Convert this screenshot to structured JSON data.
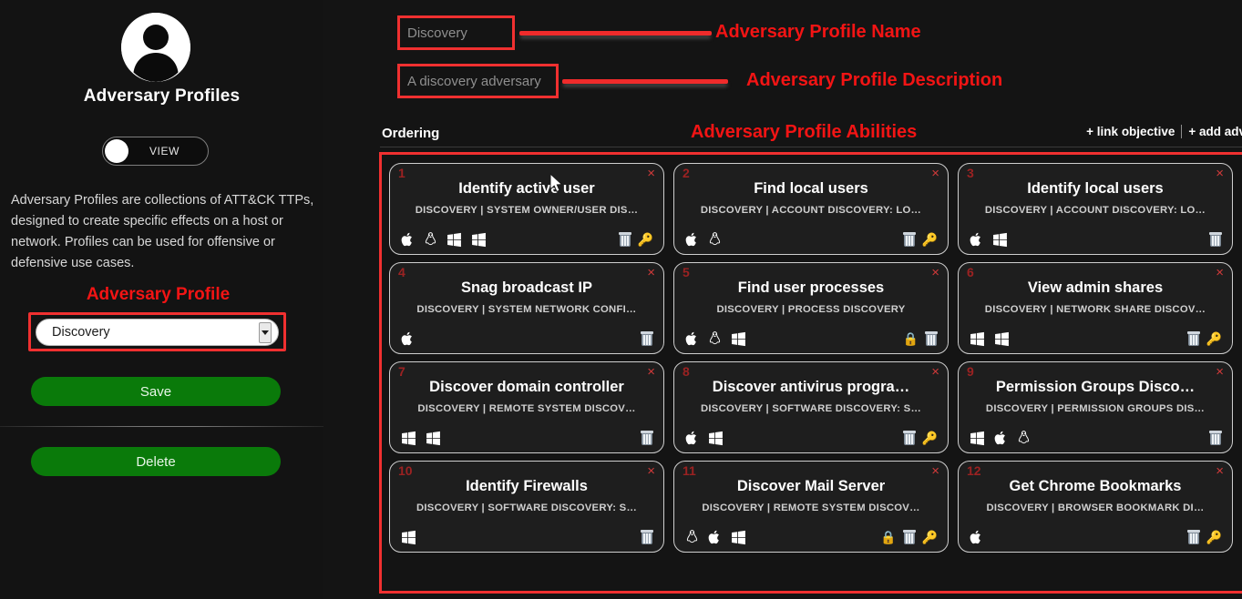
{
  "sidebar": {
    "avatar_icon": "user-avatar-icon",
    "title": "Adversary Profiles",
    "toggle_label": "VIEW",
    "description": "Adversary Profiles are collections of ATT&CK TTPs, designed to create specific effects on a host or network. Profiles can be used for offensive or defensive use cases.",
    "section_heading": "Adversary Profile",
    "select_value": "Discovery",
    "save_label": "Save",
    "delete_label": "Delete"
  },
  "main": {
    "profile_name_value": "Discovery",
    "profile_desc_value": "A discovery adversary",
    "ordering_label": "Ordering",
    "link_objective_label": "+ link objective",
    "add_adversary_label": "+ add adv"
  },
  "annotations": {
    "name": "Adversary Profile Name",
    "description": "Adversary Profile Description",
    "abilities": "Adversary Profile Abilities",
    "color": "#f31414"
  },
  "colors": {
    "accent_red": "#f03030",
    "green_button": "#0a7a0a",
    "card_bg": "#1e1e1e",
    "page_bg": "#131313"
  },
  "abilities": [
    {
      "num": "1",
      "title": "Identify active user",
      "tags": "DISCOVERY | SYSTEM OWNER/USER DIS…",
      "platforms": [
        "apple-icon",
        "linux-icon",
        "windows-icon",
        "windows-icon"
      ],
      "actions": [
        "trash-icon",
        "key-icon"
      ]
    },
    {
      "num": "2",
      "title": "Find local users",
      "tags": "DISCOVERY | ACCOUNT DISCOVERY: LO…",
      "platforms": [
        "apple-icon",
        "linux-icon"
      ],
      "actions": [
        "trash-icon",
        "key-icon"
      ]
    },
    {
      "num": "3",
      "title": "Identify local users",
      "tags": "DISCOVERY | ACCOUNT DISCOVERY: LO…",
      "platforms": [
        "apple-icon",
        "windows-icon"
      ],
      "actions": [
        "trash-icon"
      ]
    },
    {
      "num": "4",
      "title": "Snag broadcast IP",
      "tags": "DISCOVERY | SYSTEM NETWORK CONFI…",
      "platforms": [
        "apple-icon"
      ],
      "actions": [
        "trash-icon"
      ]
    },
    {
      "num": "5",
      "title": "Find user processes",
      "tags": "DISCOVERY | PROCESS DISCOVERY",
      "platforms": [
        "apple-icon",
        "linux-icon",
        "windows-icon"
      ],
      "actions": [
        "lock-icon",
        "trash-icon"
      ]
    },
    {
      "num": "6",
      "title": "View admin shares",
      "tags": "DISCOVERY | NETWORK SHARE DISCOV…",
      "platforms": [
        "windows-icon",
        "windows-icon"
      ],
      "actions": [
        "trash-icon",
        "key-icon"
      ]
    },
    {
      "num": "7",
      "title": "Discover domain controller",
      "tags": "DISCOVERY | REMOTE SYSTEM DISCOV…",
      "platforms": [
        "windows-icon",
        "windows-icon"
      ],
      "actions": [
        "trash-icon"
      ]
    },
    {
      "num": "8",
      "title": "Discover antivirus progra…",
      "tags": "DISCOVERY | SOFTWARE DISCOVERY: S…",
      "platforms": [
        "apple-icon",
        "windows-icon"
      ],
      "actions": [
        "trash-icon",
        "key-icon"
      ]
    },
    {
      "num": "9",
      "title": "Permission Groups Disco…",
      "tags": "DISCOVERY | PERMISSION GROUPS DIS…",
      "platforms": [
        "windows-icon",
        "apple-icon",
        "linux-icon"
      ],
      "actions": [
        "trash-icon"
      ]
    },
    {
      "num": "10",
      "title": "Identify Firewalls",
      "tags": "DISCOVERY | SOFTWARE DISCOVERY: S…",
      "platforms": [
        "windows-icon"
      ],
      "actions": [
        "trash-icon"
      ]
    },
    {
      "num": "11",
      "title": "Discover Mail Server",
      "tags": "DISCOVERY | REMOTE SYSTEM DISCOV…",
      "platforms": [
        "linux-icon",
        "apple-icon",
        "windows-icon"
      ],
      "actions": [
        "lock-icon",
        "trash-icon",
        "key-icon"
      ]
    },
    {
      "num": "12",
      "title": "Get Chrome Bookmarks",
      "tags": "DISCOVERY | BROWSER BOOKMARK DI…",
      "platforms": [
        "apple-icon"
      ],
      "actions": [
        "trash-icon",
        "key-icon"
      ]
    }
  ],
  "card_close_glyph": "×"
}
